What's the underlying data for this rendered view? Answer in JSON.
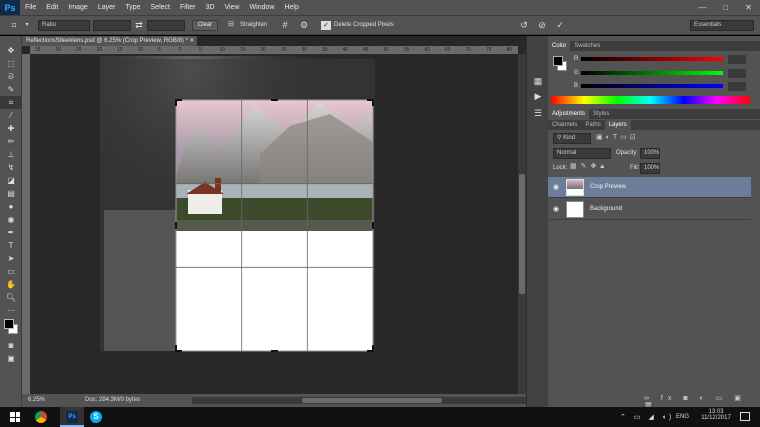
{
  "app": {
    "logo": "Ps"
  },
  "menu": [
    "File",
    "Edit",
    "Image",
    "Layer",
    "Type",
    "Select",
    "Filter",
    "3D",
    "View",
    "Window",
    "Help"
  ],
  "window_controls": [
    "—",
    "□",
    "✕"
  ],
  "options": {
    "ratio": "Ratio",
    "clear_label": "Clear",
    "straighten_label": "Straighten",
    "delete_cropped_label": "Delete Cropped Pixels",
    "workspace": "Essentials"
  },
  "document": {
    "tab_title": "ReflectionsStleeklens.psd @ 6.25% (Crop Preview, RGB/8) *",
    "ruler_numbers": [
      "35",
      "30",
      "25",
      "20",
      "15",
      "10",
      "5",
      "0",
      "5",
      "10",
      "15",
      "20",
      "25",
      "30",
      "35",
      "40",
      "45",
      "50",
      "55",
      "60",
      "65",
      "70",
      "75",
      "80"
    ],
    "zoom": "6.25%",
    "doc_info": "Doc: 284.3M/0 bytes"
  },
  "color_panel": {
    "tabs": [
      "Color",
      "Swatches"
    ],
    "channels": [
      "R",
      "G",
      "B"
    ]
  },
  "adjust_panel": {
    "tabs": [
      "Adjustments",
      "Styles"
    ]
  },
  "layers_panel": {
    "tabs": [
      "Channels",
      "Paths",
      "Layers"
    ],
    "kind_label": "Kind",
    "blend_mode": "Normal",
    "opacity_label": "Opacity:",
    "opacity_value": "100%",
    "lock_label": "Lock:",
    "fill_label": "Fill:",
    "fill_value": "100%",
    "layers": [
      {
        "name": "Crop Preview",
        "selected": true
      },
      {
        "name": "Background",
        "selected": false
      }
    ]
  },
  "taskbar": {
    "language": "ENG",
    "time": "13:03",
    "date": "11/12/2017"
  },
  "colors": {
    "accent": "#31a8ff",
    "selected_layer": "#6b7d99",
    "ui": "#535353"
  }
}
